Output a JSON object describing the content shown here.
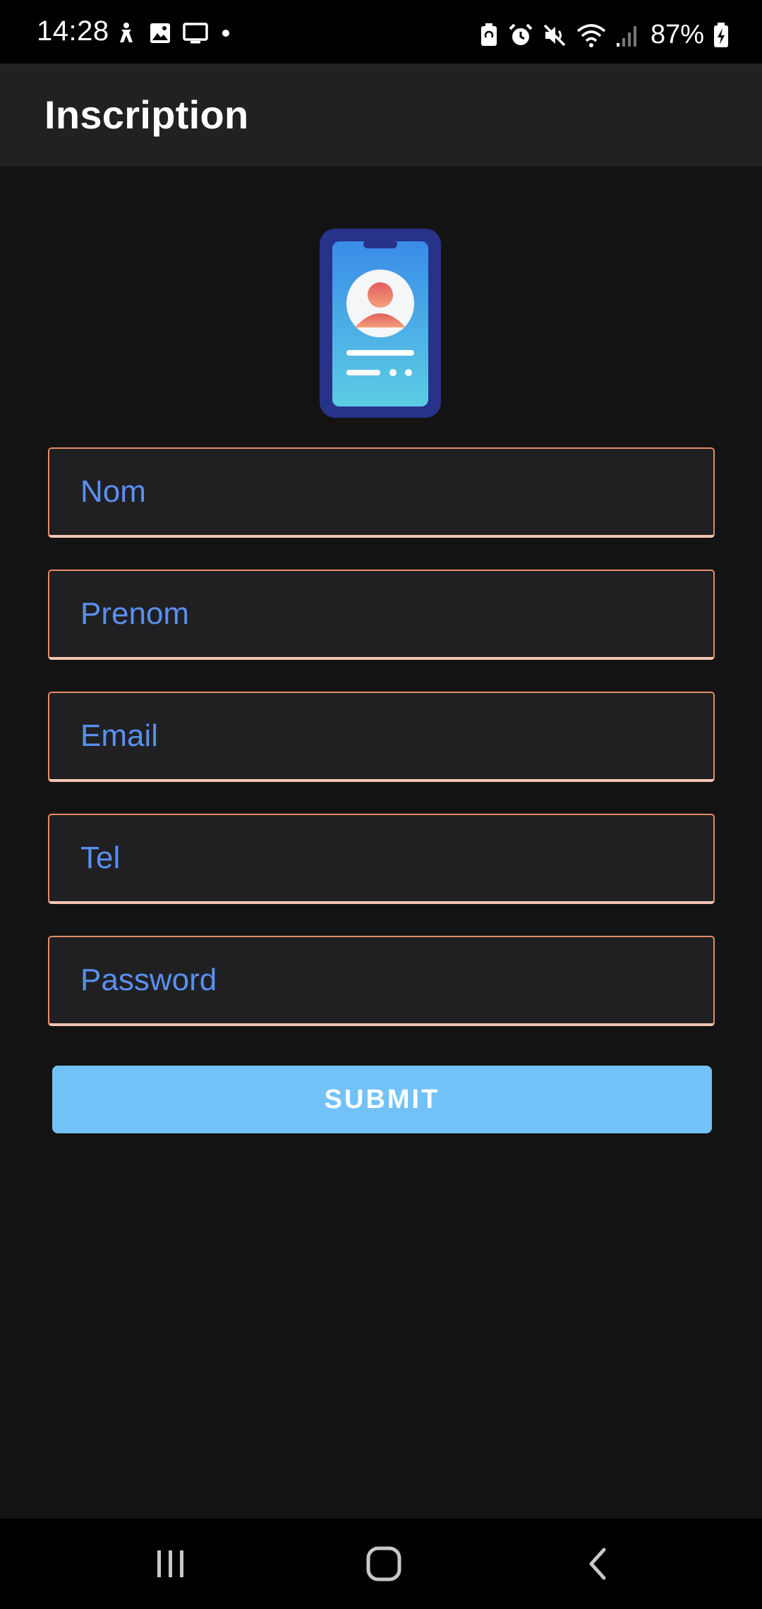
{
  "status_bar": {
    "time": "14:28",
    "battery": "87%",
    "icons_left": [
      "accessibility-icon",
      "gallery-icon",
      "screen-cast-icon",
      "dot-icon"
    ],
    "icons_right": [
      "battery-saver-icon",
      "alarm-icon",
      "mute-icon",
      "wifi-icon",
      "signal-icon",
      "battery-icon"
    ]
  },
  "app_bar": {
    "title": "Inscription"
  },
  "illustration": {
    "icon": "phone-profile-icon"
  },
  "form": {
    "nom_placeholder": "Nom",
    "prenom_placeholder": "Prenom",
    "email_placeholder": "Email",
    "tel_placeholder": "Tel",
    "password_placeholder": "Password",
    "submit_label": "SUBMIT"
  },
  "nav_bar": {
    "items": [
      "recents-icon",
      "home-icon",
      "back-icon"
    ]
  },
  "colors": {
    "background": "#131313",
    "app_bar": "#212121",
    "field_border": "#e88a64",
    "placeholder": "#5b8ff0",
    "button": "#73c2f7"
  }
}
